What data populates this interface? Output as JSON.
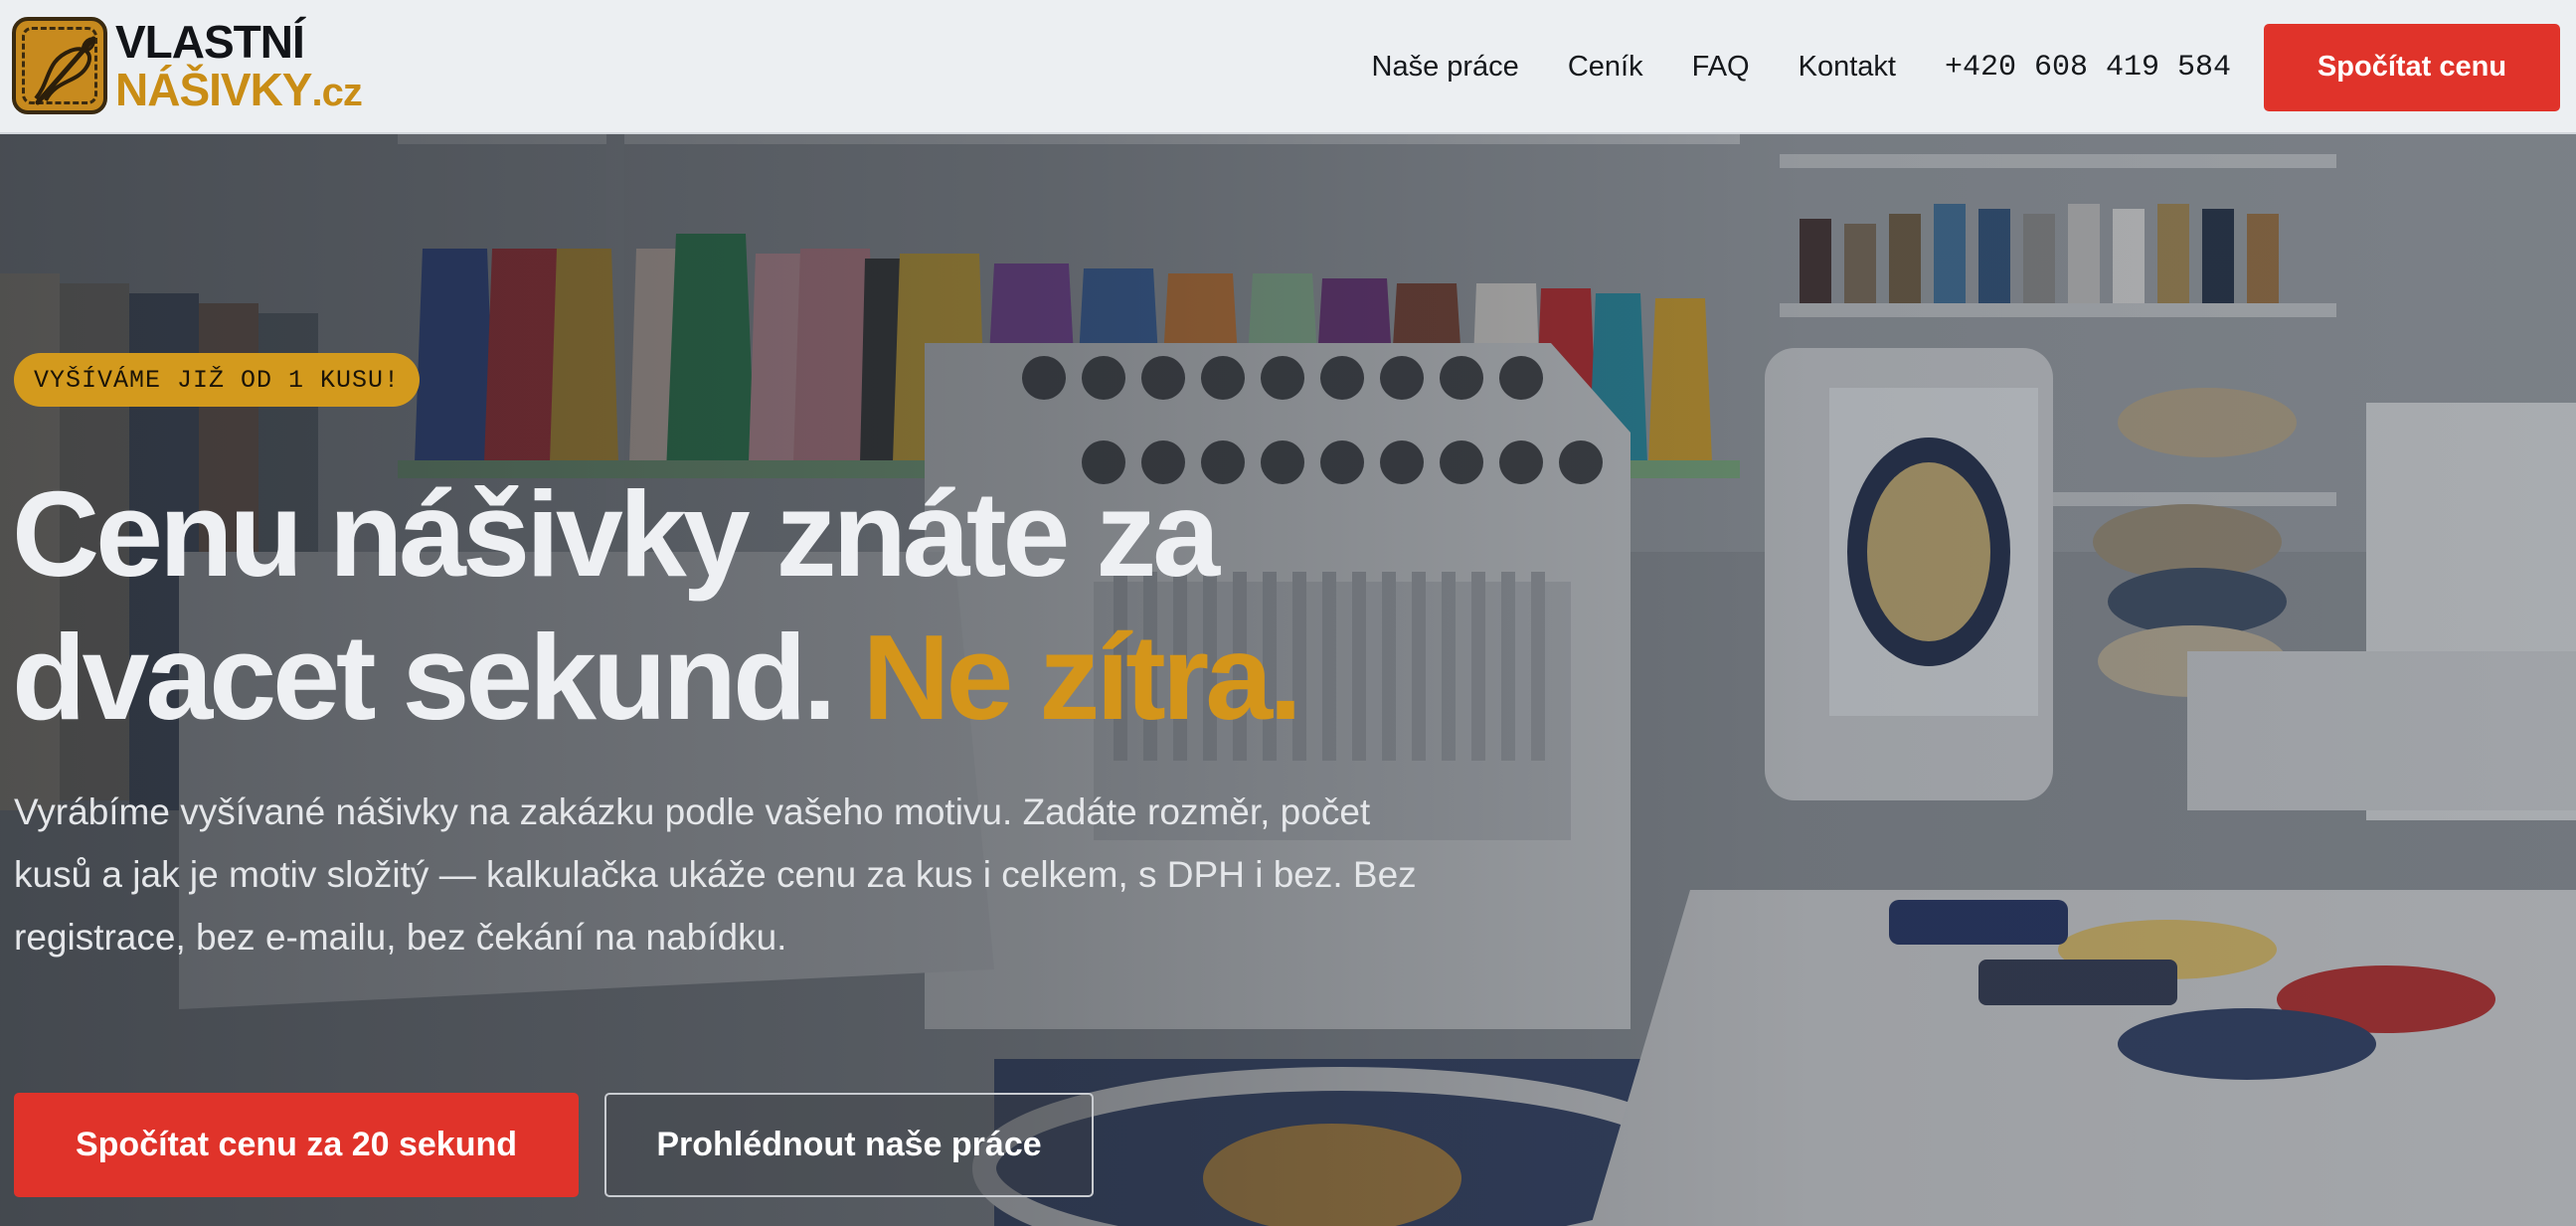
{
  "brand": {
    "line1": "VLASTNÍ",
    "line2": "NÁŠIVKY",
    "tld": ".cz",
    "logo_icon": "needle-thread-icon"
  },
  "nav": {
    "items": [
      "Naše práce",
      "Ceník",
      "FAQ",
      "Kontakt"
    ],
    "phone": "+420 608 419 584",
    "cta": "Spočítat cenu"
  },
  "hero": {
    "badge": "VYŠÍVÁME JIŽ OD 1 KUSU!",
    "headline_part1": "Cenu nášivky znáte za dvacet sekund.",
    "headline_accent": "Ne zítra.",
    "lead": "Vyrábíme vyšívané nášivky na zakázku podle vašeho motivu. Zadáte rozměr, počet kusů a jak je motiv složitý — kalkulačka ukáže cenu za kus i celkem, s DPH i bez. Bez registrace, bez e-mailu, bez čekání na nabídku.",
    "primary_button": "Spočítat cenu za 20 sekund",
    "secondary_button": "Prohlédnout naše práce",
    "background_image": "embroidery-machine-photo"
  },
  "colors": {
    "accent_red": "#e0332a",
    "accent_gold": "#d4951a",
    "header_bg": "#eceff2"
  }
}
